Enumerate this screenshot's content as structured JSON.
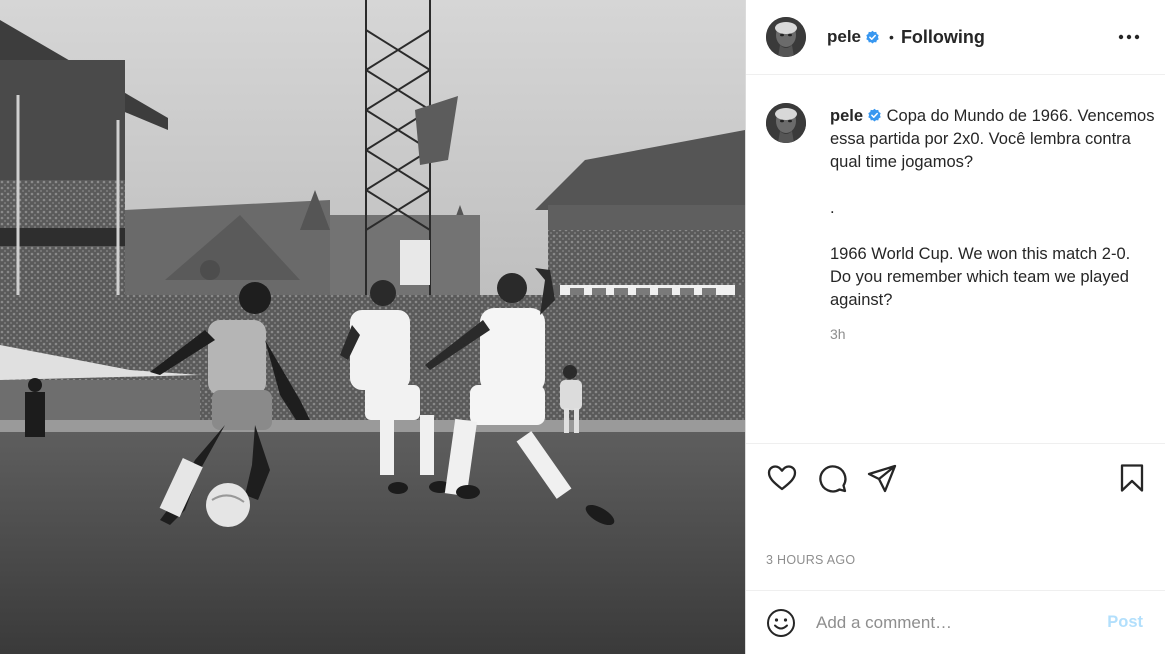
{
  "post": {
    "image_alt": "Black and white photo of footballers competing for the ball in a stadium",
    "author": {
      "username": "pele",
      "verified": true,
      "avatar_icon": "profile-avatar"
    },
    "header": {
      "separator": "•",
      "follow_status": "Following",
      "more_icon": "more-options-icon"
    },
    "caption": {
      "username": "pele",
      "text": "Copa do Mundo de 1966. Vencemos essa partida por 2x0. Você lembra contra qual time jogamos?\n\n.\n\n1966 World Cup. We won this match 2-0. Do you remember which team we played against?",
      "relative_time": "3h"
    },
    "actions": {
      "like_icon": "heart-icon",
      "comment_icon": "comment-icon",
      "share_icon": "share-icon",
      "save_icon": "bookmark-icon"
    },
    "timestamp": "3 HOURS AGO",
    "comment_box": {
      "emoji_icon": "emoji-icon",
      "placeholder": "Add a comment…",
      "post_label": "Post"
    },
    "colors": {
      "verified_blue": "#3897f0",
      "post_disabled": "#b2dffc",
      "muted_text": "#8e8e8e",
      "border": "#dbdbdb"
    }
  }
}
